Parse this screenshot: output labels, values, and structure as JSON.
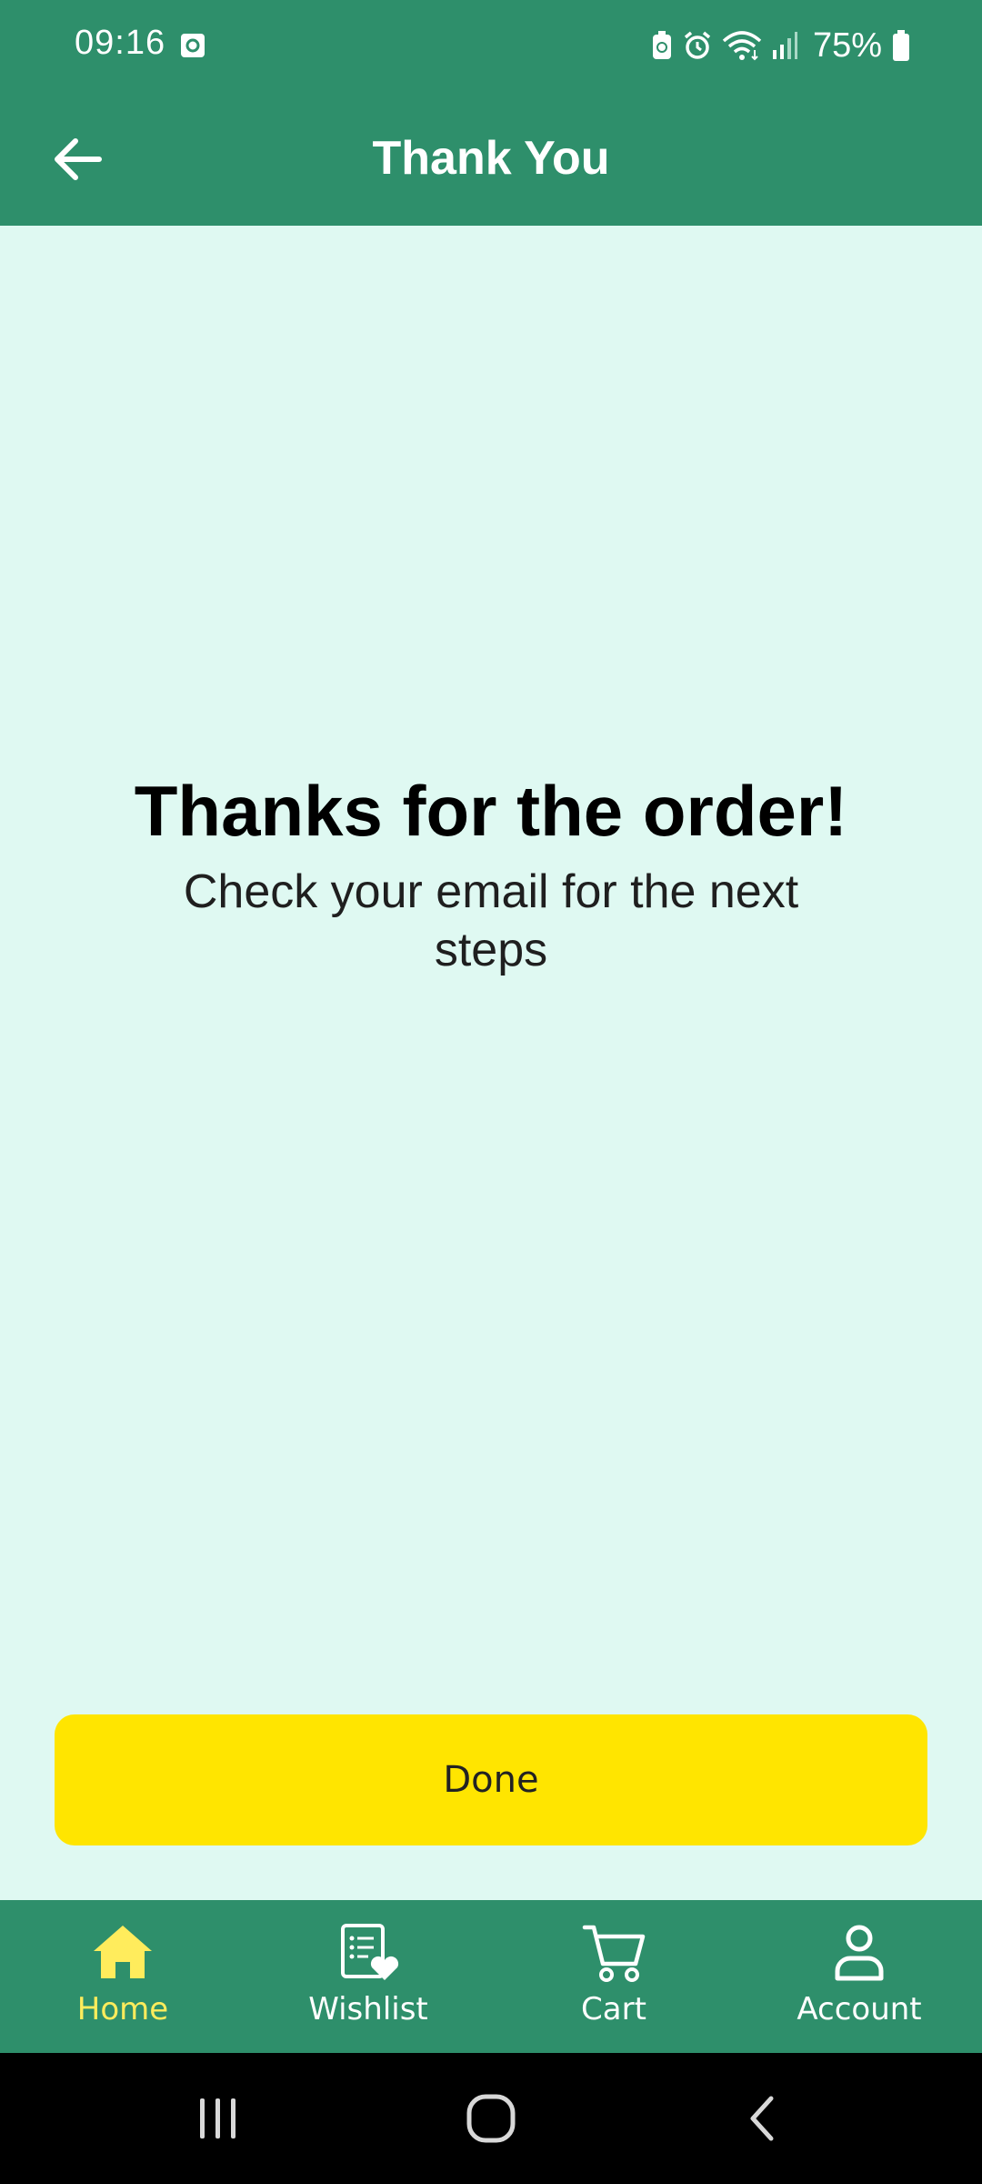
{
  "status_bar": {
    "time": "09:16",
    "battery": "75%"
  },
  "app_bar": {
    "title": "Thank You"
  },
  "content": {
    "headline": "Thanks for the order!",
    "message": "Check your email for the next steps"
  },
  "actions": {
    "done_label": "Done"
  },
  "bottom_nav": {
    "items": [
      {
        "label": "Home",
        "icon": "home-icon",
        "active": true
      },
      {
        "label": "Wishlist",
        "icon": "wishlist-icon",
        "active": false
      },
      {
        "label": "Cart",
        "icon": "cart-icon",
        "active": false
      },
      {
        "label": "Account",
        "icon": "account-icon",
        "active": false
      }
    ]
  },
  "colors": {
    "primary": "#2e8f6b",
    "background": "#dff9f2",
    "accent": "#ffe500",
    "active_nav": "#ffec5c"
  }
}
